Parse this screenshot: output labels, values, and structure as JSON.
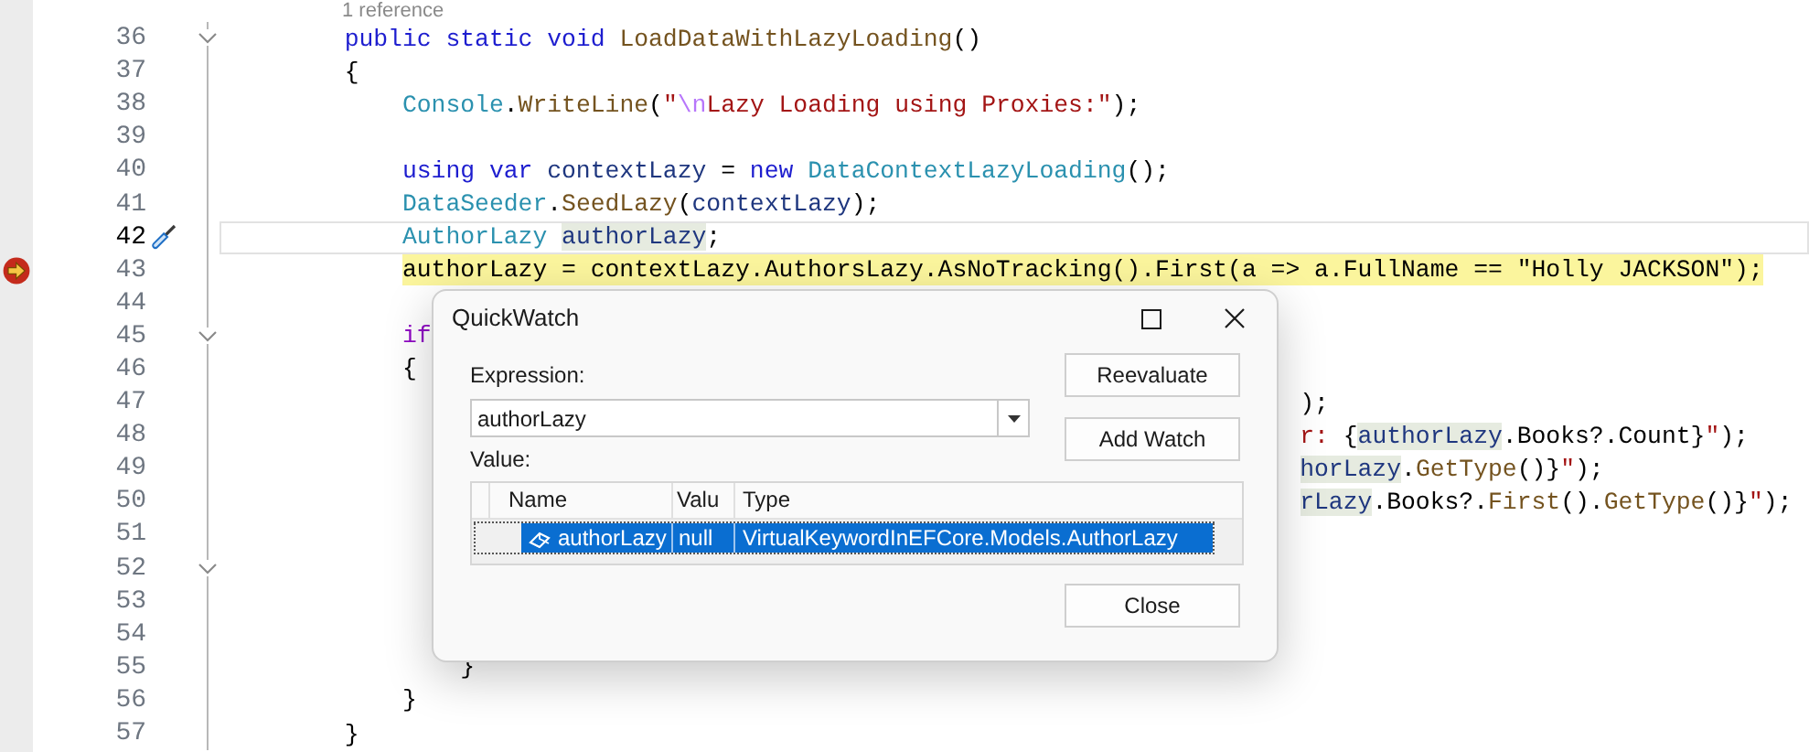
{
  "editor": {
    "codelens": "1 reference",
    "lines": [
      {
        "number": "36",
        "fold": true,
        "tokens": [
          {
            "kind": "kw",
            "text": "        public static void "
          },
          {
            "kind": "method",
            "text": "LoadDataWithLazyLoading"
          },
          {
            "kind": "plain",
            "text": "()"
          }
        ]
      },
      {
        "number": "37",
        "tokens": [
          {
            "kind": "plain",
            "text": "        {"
          }
        ]
      },
      {
        "number": "38",
        "tokens": [
          {
            "kind": "type",
            "text": "            Console"
          },
          {
            "kind": "plain",
            "text": "."
          },
          {
            "kind": "method",
            "text": "WriteLine"
          },
          {
            "kind": "plain",
            "text": "("
          },
          {
            "kind": "str",
            "text": "\""
          },
          {
            "kind": "esc",
            "text": "\\n"
          },
          {
            "kind": "str",
            "text": "Lazy Loading using Proxies:\""
          },
          {
            "kind": "plain",
            "text": ");"
          }
        ]
      },
      {
        "number": "39"
      },
      {
        "number": "40",
        "tokens": [
          {
            "kind": "kw",
            "text": "            using var "
          },
          {
            "kind": "local",
            "text": "contextLazy"
          },
          {
            "kind": "plain",
            "text": " = "
          },
          {
            "kind": "kw",
            "text": "new "
          },
          {
            "kind": "type",
            "text": "DataContextLazyLoading"
          },
          {
            "kind": "plain",
            "text": "();"
          }
        ]
      },
      {
        "number": "41",
        "tokens": [
          {
            "kind": "type",
            "text": "            DataSeeder"
          },
          {
            "kind": "plain",
            "text": "."
          },
          {
            "kind": "method",
            "text": "SeedLazy"
          },
          {
            "kind": "plain",
            "text": "("
          },
          {
            "kind": "local",
            "text": "contextLazy"
          },
          {
            "kind": "plain",
            "text": ");"
          }
        ]
      },
      {
        "number": "42",
        "caret": true,
        "edit_glyph": true,
        "tokens": [
          {
            "kind": "type",
            "text": "            AuthorLazy "
          },
          {
            "kind": "local",
            "text": "authorLazy",
            "highlight": true
          },
          {
            "kind": "plain",
            "text": ";"
          }
        ]
      },
      {
        "number": "43",
        "current": true,
        "tokens": [
          {
            "kind": "plain",
            "text": "            authorLazy = contextLazy.AuthorsLazy.AsNoTracking().First(a => a.FullName == \"Holly JACKSON\");"
          }
        ]
      },
      {
        "number": "44"
      },
      {
        "number": "45",
        "fold": true,
        "tokens": [
          {
            "kind": "ctrl",
            "text": "            if"
          }
        ]
      },
      {
        "number": "46",
        "tokens": [
          {
            "kind": "plain",
            "text": "            {"
          }
        ]
      },
      {
        "number": "47",
        "kind": "partial",
        "tokens": [
          {
            "kind": "plain",
            "text": ");"
          }
        ]
      },
      {
        "number": "48",
        "kind": "partial",
        "tokens": [
          {
            "kind": "str",
            "text": "r: "
          },
          {
            "kind": "plain",
            "text": "{"
          },
          {
            "kind": "local",
            "text": "authorLazy",
            "highlight": true
          },
          {
            "kind": "plain",
            "text": ".Books?.Count}"
          },
          {
            "kind": "str",
            "text": "\""
          },
          {
            "kind": "plain",
            "text": ");"
          }
        ]
      },
      {
        "number": "49",
        "kind": "partial",
        "tokens": [
          {
            "kind": "local",
            "text": "horLazy",
            "highlight": true
          },
          {
            "kind": "plain",
            "text": "."
          },
          {
            "kind": "method",
            "text": "GetType"
          },
          {
            "kind": "plain",
            "text": "()}"
          },
          {
            "kind": "str",
            "text": "\""
          },
          {
            "kind": "plain",
            "text": ");"
          }
        ]
      },
      {
        "number": "50",
        "kind": "partial",
        "tokens": [
          {
            "kind": "local",
            "text": "rLazy",
            "highlight": true
          },
          {
            "kind": "plain",
            "text": ".Books?."
          },
          {
            "kind": "method",
            "text": "First"
          },
          {
            "kind": "plain",
            "text": "()."
          },
          {
            "kind": "method",
            "text": "GetType"
          },
          {
            "kind": "plain",
            "text": "()}"
          },
          {
            "kind": "str",
            "text": "\""
          },
          {
            "kind": "plain",
            "text": ");"
          }
        ]
      },
      {
        "number": "51"
      },
      {
        "number": "52",
        "fold": true
      },
      {
        "number": "53"
      },
      {
        "number": "54"
      },
      {
        "number": "55",
        "tokens": [
          {
            "kind": "plain",
            "text": "                }"
          }
        ]
      },
      {
        "number": "56",
        "tokens": [
          {
            "kind": "plain",
            "text": "            }"
          }
        ]
      },
      {
        "number": "57",
        "tokens": [
          {
            "kind": "plain",
            "text": "        }"
          }
        ]
      }
    ]
  },
  "dialog": {
    "title": "QuickWatch",
    "expression_label": "Expression:",
    "expression": "authorLazy",
    "value_label": "Value:",
    "columns": [
      "Name",
      "Valu",
      "Type"
    ],
    "rows": [
      {
        "name": "authorLazy",
        "value": "null",
        "type": "VirtualKeywordInEFCore.Models.AuthorLazy",
        "selected": true
      }
    ],
    "side_buttons": [
      "Reevaluate",
      "Add Watch"
    ],
    "close_button": "Close"
  }
}
